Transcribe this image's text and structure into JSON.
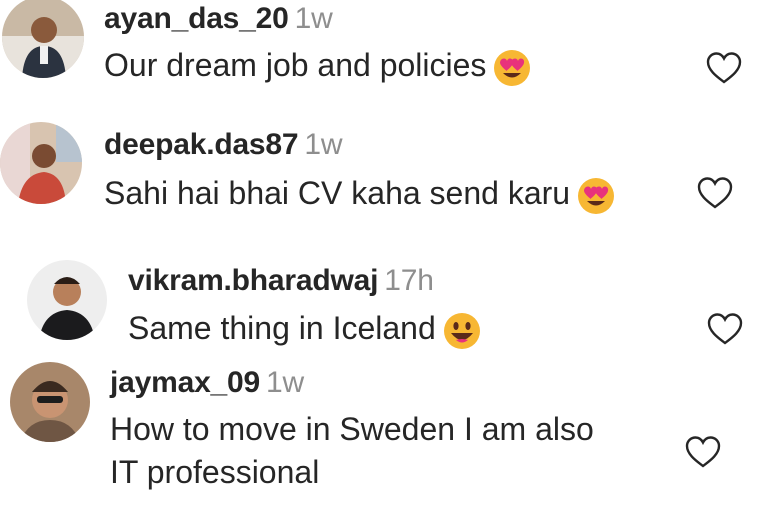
{
  "comments": [
    {
      "username": "ayan_das_20",
      "time": "1w",
      "text": "Our dream job and policies",
      "emoji": "heart-eyes-emoji"
    },
    {
      "username": "deepak.das87",
      "time": "1w",
      "text": "Sahi hai bhai CV kaha send karu",
      "emoji": "heart-eyes-emoji"
    },
    {
      "username": "vikram.bharadwaj",
      "time": "17h",
      "text": "Same thing in Iceland",
      "emoji": "grinning-face-emoji"
    },
    {
      "username": "jaymax_09",
      "time": "1w",
      "text_line1": "How to move in Sweden I am also",
      "text_line2": "IT professional"
    }
  ],
  "colors": {
    "text": "#262626",
    "muted": "#8e8e8e",
    "heart_stroke": "#262626"
  }
}
